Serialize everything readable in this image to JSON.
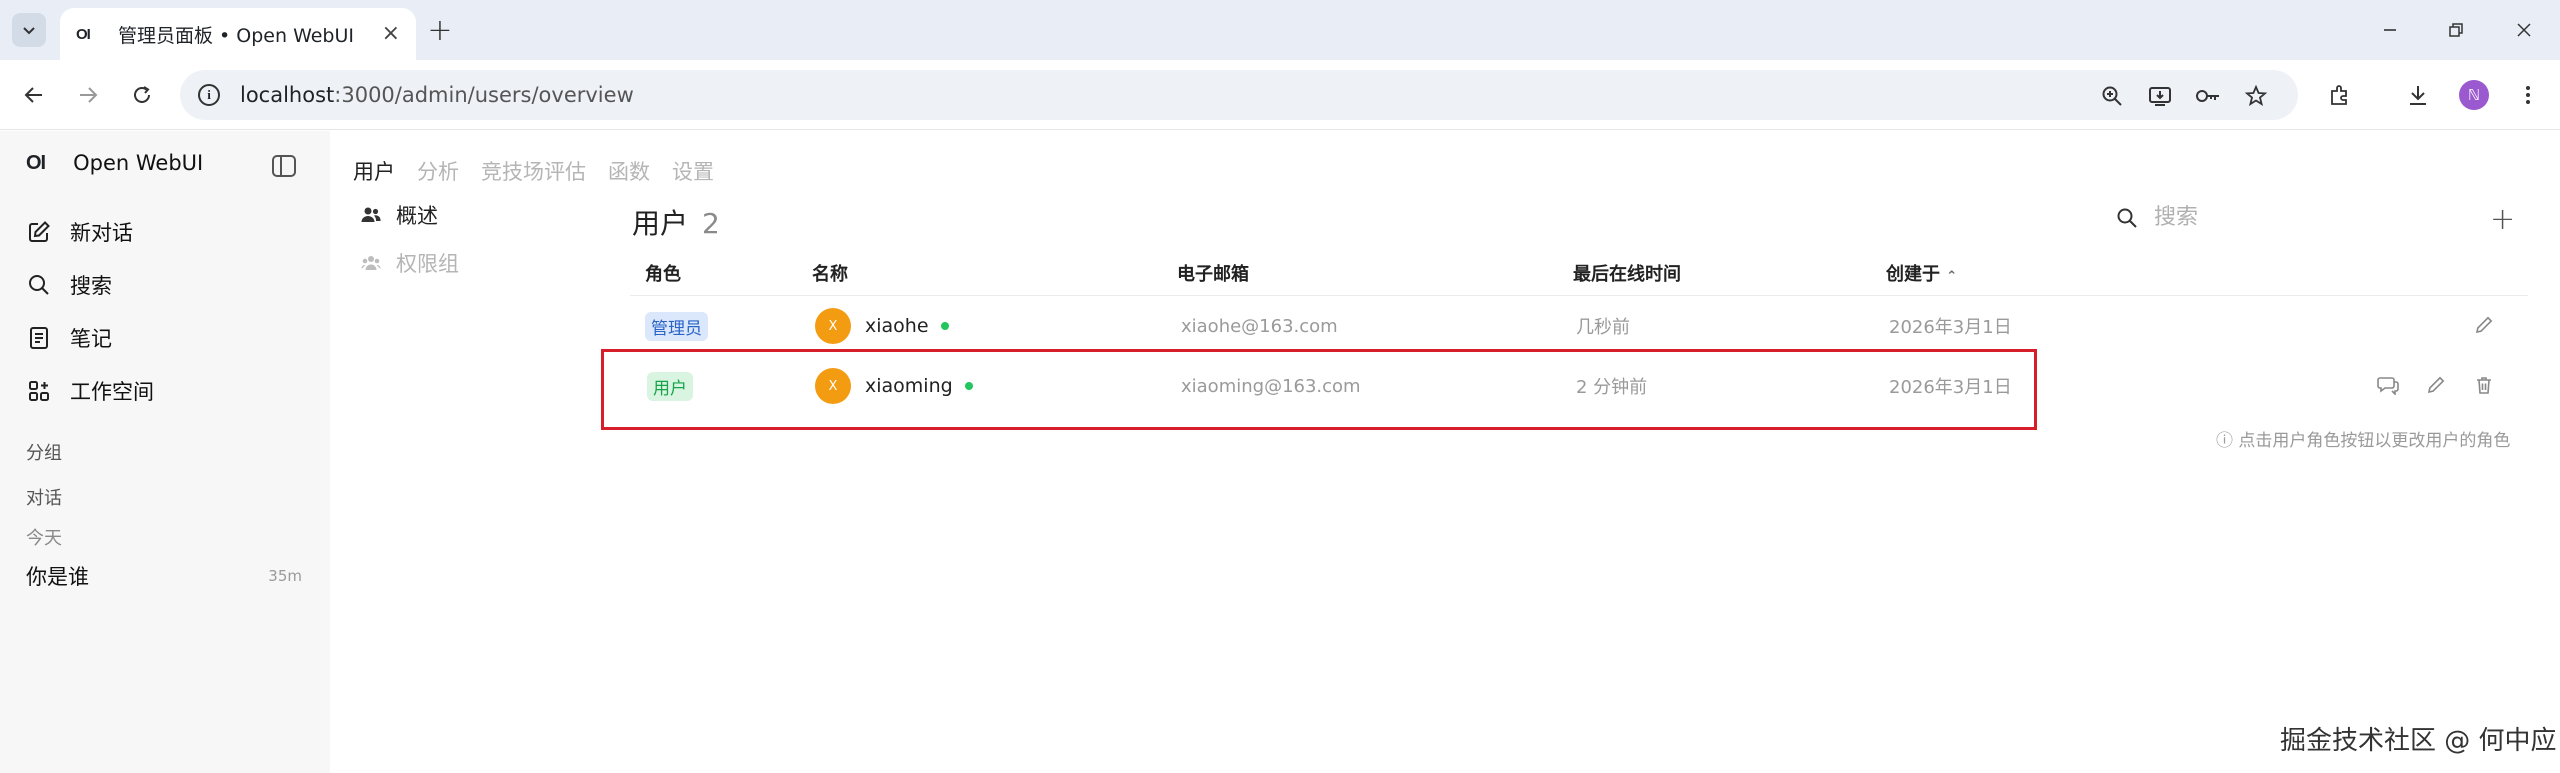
{
  "browser": {
    "tab_title": "管理员面板 • Open WebUI",
    "tab_favicon": "OI",
    "url_host": "localhost",
    "url_rest": ":3000/admin/users/overview",
    "profile_initial": "ℕ"
  },
  "sidebar": {
    "brand_logo": "OI",
    "brand_name": "Open WebUI",
    "items": [
      {
        "label": "新对话",
        "icon": "pencil-square-icon"
      },
      {
        "label": "搜索",
        "icon": "search-icon"
      },
      {
        "label": "笔记",
        "icon": "notes-icon"
      },
      {
        "label": "工作空间",
        "icon": "grid-icon"
      }
    ],
    "groups_label": "分组",
    "chats_label": "对话",
    "today_label": "今天",
    "chat_items": [
      {
        "title": "你是谁",
        "time": "35m"
      }
    ]
  },
  "admin_tabs": [
    "用户",
    "分析",
    "竞技场评估",
    "函数",
    "设置"
  ],
  "subnav": {
    "overview": "概述",
    "permission_groups": "权限组"
  },
  "main": {
    "title": "用户",
    "count": "2",
    "search_placeholder": "搜索",
    "add_label": "+",
    "columns": {
      "role": "角色",
      "name": "名称",
      "email": "电子邮箱",
      "last_active": "最后在线时间",
      "created": "创建于",
      "sort_indicator": "⌃"
    },
    "users": [
      {
        "role": "管理员",
        "role_type": "admin",
        "avatar": "X",
        "name": "xiaohe",
        "email": "xiaohe@163.com",
        "last_active": "几秒前",
        "created": "2026年3月1日"
      },
      {
        "role": "用户",
        "role_type": "user",
        "avatar": "X",
        "name": "xiaoming",
        "email": "xiaoming@163.com",
        "last_active": "2 分钟前",
        "created": "2026年3月1日"
      }
    ],
    "hint": "ⓘ 点击用户角色按钮以更改用户的角色"
  },
  "watermark": "掘金技术社区 @ 何中应",
  "colors": {
    "highlight": "#d71f2b",
    "admin_badge": "#2a64c8",
    "user_badge": "#17a34a",
    "avatar": "#f39c12",
    "online": "#22c55e"
  }
}
